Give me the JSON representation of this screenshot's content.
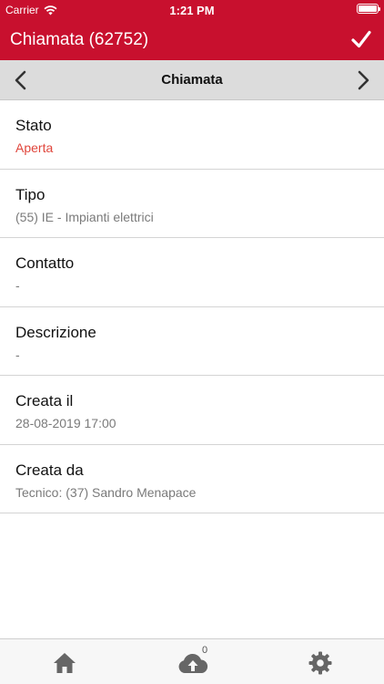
{
  "status": {
    "carrier": "Carrier",
    "time": "1:21 PM"
  },
  "header": {
    "title": "Chiamata (62752)"
  },
  "subbar": {
    "title": "Chiamata"
  },
  "fields": [
    {
      "label": "Stato",
      "value": "Aperta"
    },
    {
      "label": "Tipo",
      "value": "(55) IE - Impianti elettrici"
    },
    {
      "label": "Contatto",
      "value": "-"
    },
    {
      "label": "Descrizione",
      "value": "-"
    },
    {
      "label": "Creata il",
      "value": "28-08-2019 17:00"
    },
    {
      "label": "Creata da",
      "value": "Tecnico: (37) Sandro Menapace"
    }
  ],
  "tabbar": {
    "upload_badge": "0"
  },
  "colors": {
    "brand": "#c8102e",
    "status_open": "#e0463c"
  },
  "icons": [
    "wifi-icon",
    "battery-icon",
    "checkmark-icon",
    "chevron-left-icon",
    "chevron-right-icon",
    "home-icon",
    "cloud-upload-icon",
    "gear-icon"
  ]
}
